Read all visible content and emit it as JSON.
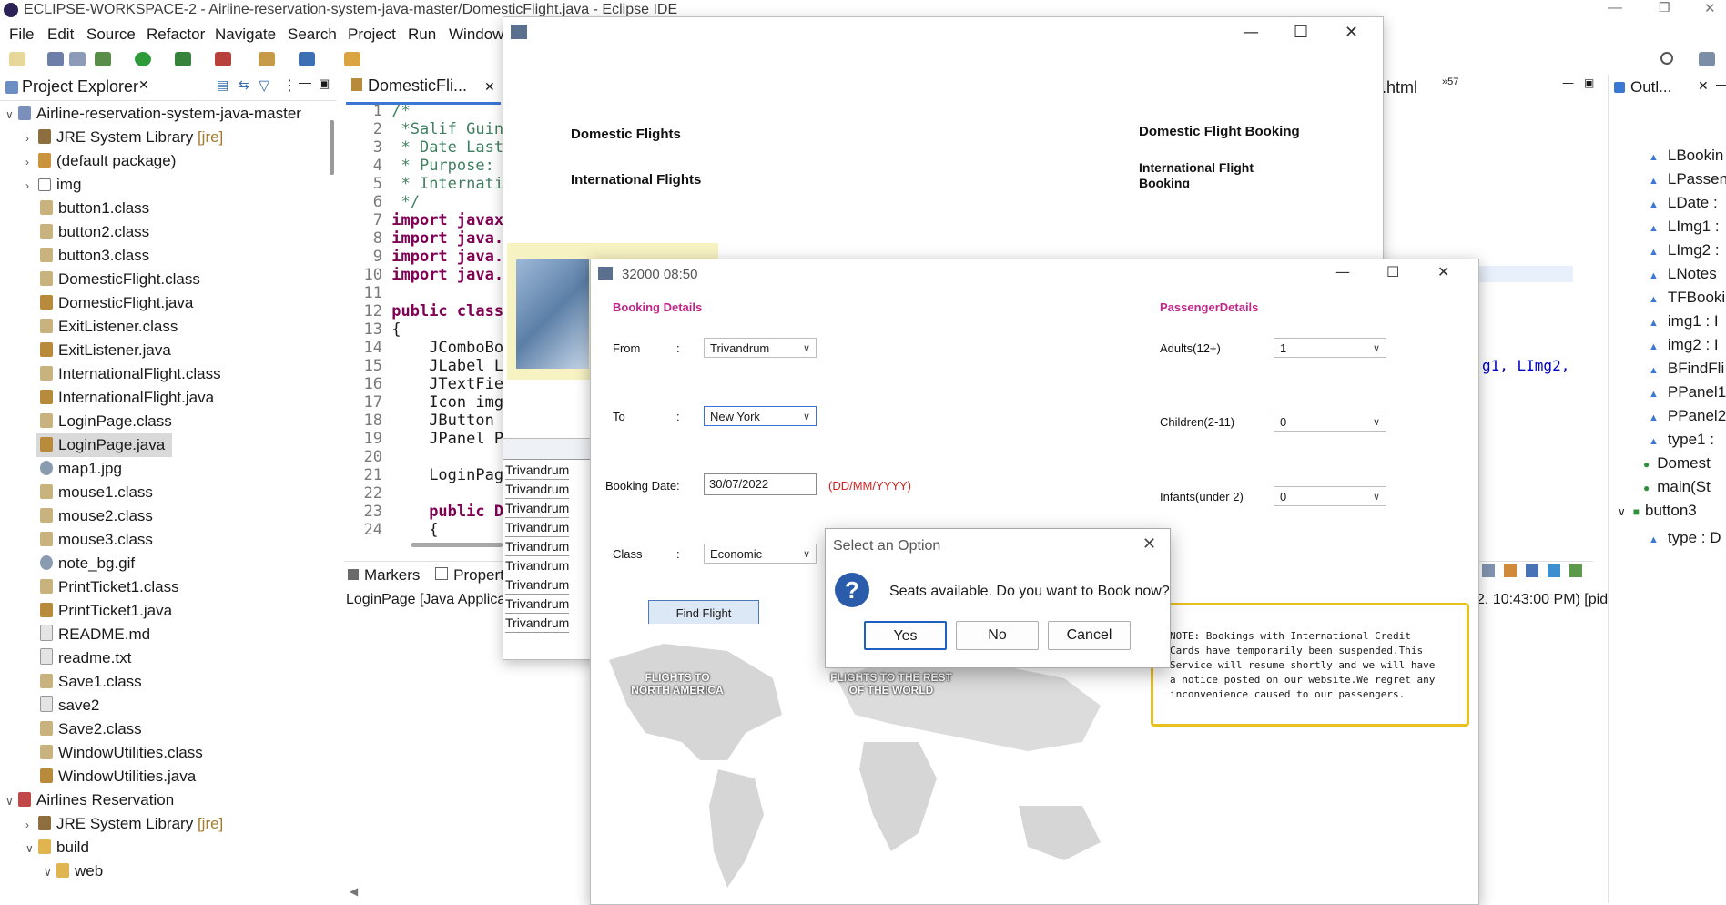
{
  "eclipse": {
    "title": "ECLIPSE-WORKSPACE-2 - Airline-reservation-system-java-master/DomesticFlight.java - Eclipse IDE",
    "menu": [
      "File",
      "Edit",
      "Source",
      "Refactor",
      "Navigate",
      "Search",
      "Project",
      "Run",
      "Window"
    ]
  },
  "project_explorer": {
    "title": "Project Explorer",
    "items": [
      {
        "label": "Airline-reservation-system-java-master",
        "icon": "project-icon"
      },
      {
        "label": "JRE System Library",
        "suffix": "[jre]",
        "icon": "library-icon"
      },
      {
        "label": "(default package)",
        "icon": "package-icon"
      },
      {
        "label": "img",
        "icon": "folder-icon"
      },
      {
        "label": "button1.class",
        "icon": "class-file-icon"
      },
      {
        "label": "button2.class",
        "icon": "class-file-icon"
      },
      {
        "label": "button3.class",
        "icon": "class-file-icon"
      },
      {
        "label": "DomesticFlight.class",
        "icon": "class-file-icon"
      },
      {
        "label": "DomesticFlight.java",
        "icon": "java-file-icon"
      },
      {
        "label": "ExitListener.class",
        "icon": "class-file-icon"
      },
      {
        "label": "ExitListener.java",
        "icon": "java-file-icon"
      },
      {
        "label": "InternationalFlight.class",
        "icon": "class-file-icon"
      },
      {
        "label": "InternationalFlight.java",
        "icon": "java-file-icon"
      },
      {
        "label": "LoginPage.class",
        "icon": "class-file-icon"
      },
      {
        "label": "LoginPage.java",
        "icon": "java-file-icon",
        "selected": true
      },
      {
        "label": "map1.jpg",
        "icon": "image-file-icon"
      },
      {
        "label": "mouse1.class",
        "icon": "class-file-icon"
      },
      {
        "label": "mouse2.class",
        "icon": "class-file-icon"
      },
      {
        "label": "mouse3.class",
        "icon": "class-file-icon"
      },
      {
        "label": "note_bg.gif",
        "icon": "image-file-icon"
      },
      {
        "label": "PrintTicket1.class",
        "icon": "class-file-icon"
      },
      {
        "label": "PrintTicket1.java",
        "icon": "java-file-icon"
      },
      {
        "label": "README.md",
        "icon": "text-file-icon"
      },
      {
        "label": "readme.txt",
        "icon": "text-file-icon"
      },
      {
        "label": "Save1.class",
        "icon": "class-file-icon"
      },
      {
        "label": "save2",
        "icon": "text-file-icon"
      },
      {
        "label": "Save2.class",
        "icon": "class-file-icon"
      },
      {
        "label": "WindowUtilities.class",
        "icon": "class-file-icon"
      },
      {
        "label": "WindowUtilities.java",
        "icon": "java-file-icon"
      },
      {
        "label": "Airlines Reservation",
        "icon": "project-icon"
      },
      {
        "label": "JRE System Library",
        "suffix": "[jre]",
        "icon": "library-icon"
      },
      {
        "label": "build",
        "icon": "folder-icon"
      },
      {
        "label": "web",
        "icon": "folder-icon"
      }
    ]
  },
  "editor": {
    "tab": "DomesticFli...",
    "right_tab": ".html",
    "overflow_count": "57",
    "lines": [
      {
        "n": "1",
        "t": "/*"
      },
      {
        "n": "2",
        "t": " *Salif Guin"
      },
      {
        "n": "3",
        "t": " * Date Last"
      },
      {
        "n": "4",
        "t": " * Purpose:"
      },
      {
        "n": "5",
        "t": " * Internati"
      },
      {
        "n": "6",
        "t": " */"
      },
      {
        "n": "7",
        "t": "import javax"
      },
      {
        "n": "8",
        "t": "import java."
      },
      {
        "n": "9",
        "t": "import java."
      },
      {
        "n": "10",
        "t": "import java."
      },
      {
        "n": "11",
        "t": ""
      },
      {
        "n": "12",
        "t": "public class"
      },
      {
        "n": "13",
        "t": "{"
      },
      {
        "n": "14",
        "t": "    JComboBo"
      },
      {
        "n": "15",
        "t": "    JLabel L"
      },
      {
        "n": "16",
        "t": "    JTextFie"
      },
      {
        "n": "17",
        "t": "    Icon img"
      },
      {
        "n": "18",
        "t": "    JButton "
      },
      {
        "n": "19",
        "t": "    JPanel P"
      },
      {
        "n": "20",
        "t": ""
      },
      {
        "n": "21",
        "t": "    LoginPag"
      },
      {
        "n": "22",
        "t": ""
      },
      {
        "n": "23",
        "t": "    public D"
      },
      {
        "n": "24",
        "t": "    {"
      }
    ],
    "code_fragment_right": "g1, LImg2,"
  },
  "console": {
    "tabs": [
      "Markers",
      "Propert"
    ],
    "text": "LoginPage [Java Applicat",
    "status_right": "2, 10:43:00 PM) [pid: 54072]"
  },
  "outline": {
    "title": "Outl...",
    "items": [
      "LBookin",
      "LPassen",
      "LDate :",
      "LImg1 :",
      "LImg2 :",
      "LNotes",
      "TFBooki",
      "img1 : I",
      "img2 : I",
      "BFindFli",
      "PPanel1",
      "PPanel2",
      "type1 :",
      "Domest",
      "main(St",
      "button3",
      "type : D"
    ]
  },
  "domestic_window": {
    "domestic": "Domestic Flights",
    "international": "International Flights",
    "domestic_booking": "Domestic Flight Booking",
    "international_booking": "International Flight Booking",
    "list_items": [
      "Trivandrum",
      "Trivandrum",
      "Trivandrum",
      "Trivandrum",
      "Trivandrum",
      "Trivandrum",
      "Trivandrum",
      "Trivandrum",
      "Trivandrum"
    ]
  },
  "booking_window": {
    "title": "32000 08:50",
    "booking_details": "Booking Details",
    "passenger_details": "PassengerDetails",
    "from_label": "From",
    "to_label": "To",
    "date_label": "Booking Date:",
    "class_label": "Class",
    "colon": ":",
    "from_value": "Trivandrum",
    "to_value": "New York",
    "date_value": "30/07/2022",
    "date_hint": "(DD/MM/YYYY)",
    "class_value": "Economic",
    "find_button": "Find Flight",
    "adults_label": "Adults(12+)",
    "adults_value": "1",
    "children_label": "Children(2-11)",
    "children_value": "0",
    "infants_label": "Infants(under 2)",
    "infants_value": "0",
    "map_left": "FLIGHTS TO NORTH AMERICA",
    "map_right": "FLIGHTS TO THE REST OF THE WORLD",
    "note": "NOTE: Bookings with International Credit Cards have temporarily been suspended.This Service will resume shortly and we will have a notice posted on our website.We regret any inconvenience caused to our passengers."
  },
  "dialog": {
    "title": "Select an Option",
    "message": "Seats available. Do you want to Book now?",
    "yes": "Yes",
    "no": "No",
    "cancel": "Cancel"
  },
  "colors": {
    "section_magenta": "#c0268a",
    "hint_red": "#d32020",
    "note_border": "#e8c020",
    "dialog_icon_blue": "#2a5caa"
  }
}
